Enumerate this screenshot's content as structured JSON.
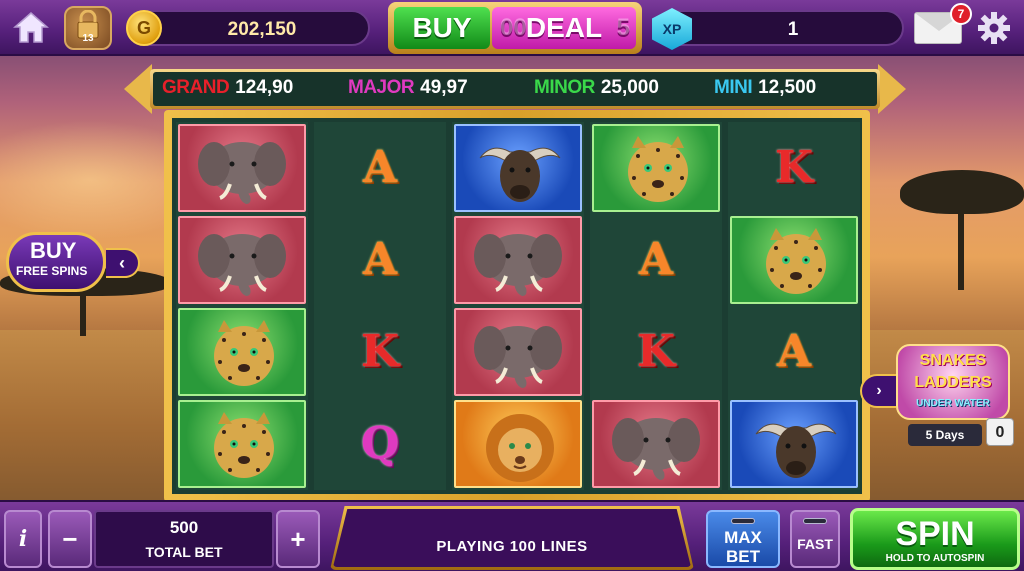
{
  "topbar": {
    "level": "13",
    "coin_symbol": "G",
    "coins": "202,150",
    "buy_label": "BUY",
    "deal_label": "DEAL",
    "deal_timer_left": "00",
    "deal_timer_right": "5",
    "xp_label": "XP",
    "xp_value": "1",
    "mail_count": "7",
    "icons": [
      "home-icon",
      "lock-icon",
      "coin-icon",
      "xp-icon",
      "mail-icon",
      "gear-icon"
    ]
  },
  "jackpots": [
    {
      "label": "GRAND",
      "value": "124,90",
      "color": "#e8202a"
    },
    {
      "label": "MAJOR",
      "value": "49,97",
      "color": "#e03ac0"
    },
    {
      "label": "MINOR",
      "value": "25,000",
      "color": "#3ad84a"
    },
    {
      "label": "MINI",
      "value": "12,500",
      "color": "#3ac8f0"
    }
  ],
  "reels": [
    [
      "elephant-red",
      "elephant-red",
      "leopard-green",
      "leopard-green"
    ],
    [
      "A",
      "A",
      "K",
      "Q"
    ],
    [
      "buffalo-blue",
      "elephant-red",
      "elephant-red",
      "lion-orange"
    ],
    [
      "leopard-green",
      "A",
      "K",
      "elephant-red"
    ],
    [
      "K",
      "leopard-green",
      "A",
      "buffalo-blue"
    ]
  ],
  "buy_free_spins": {
    "line1": "BUY",
    "line2": "FREE SPINS",
    "arrow": "‹"
  },
  "promo": {
    "line1": "SNAKES",
    "line2": "LADDERS",
    "line3": "UNDER WATER",
    "days": "5 Days",
    "count": "0",
    "arrow": "›"
  },
  "bottombar": {
    "info_label": "i",
    "minus_label": "−",
    "total_bet_value": "500",
    "total_bet_label": "TOTAL BET",
    "plus_label": "+",
    "lines_text": "PLAYING 100 LINES",
    "max_bet_line1": "MAX",
    "max_bet_line2": "BET",
    "fast_label": "FAST",
    "spin_label": "SPIN",
    "spin_sub": "HOLD TO AUTOSPIN"
  }
}
